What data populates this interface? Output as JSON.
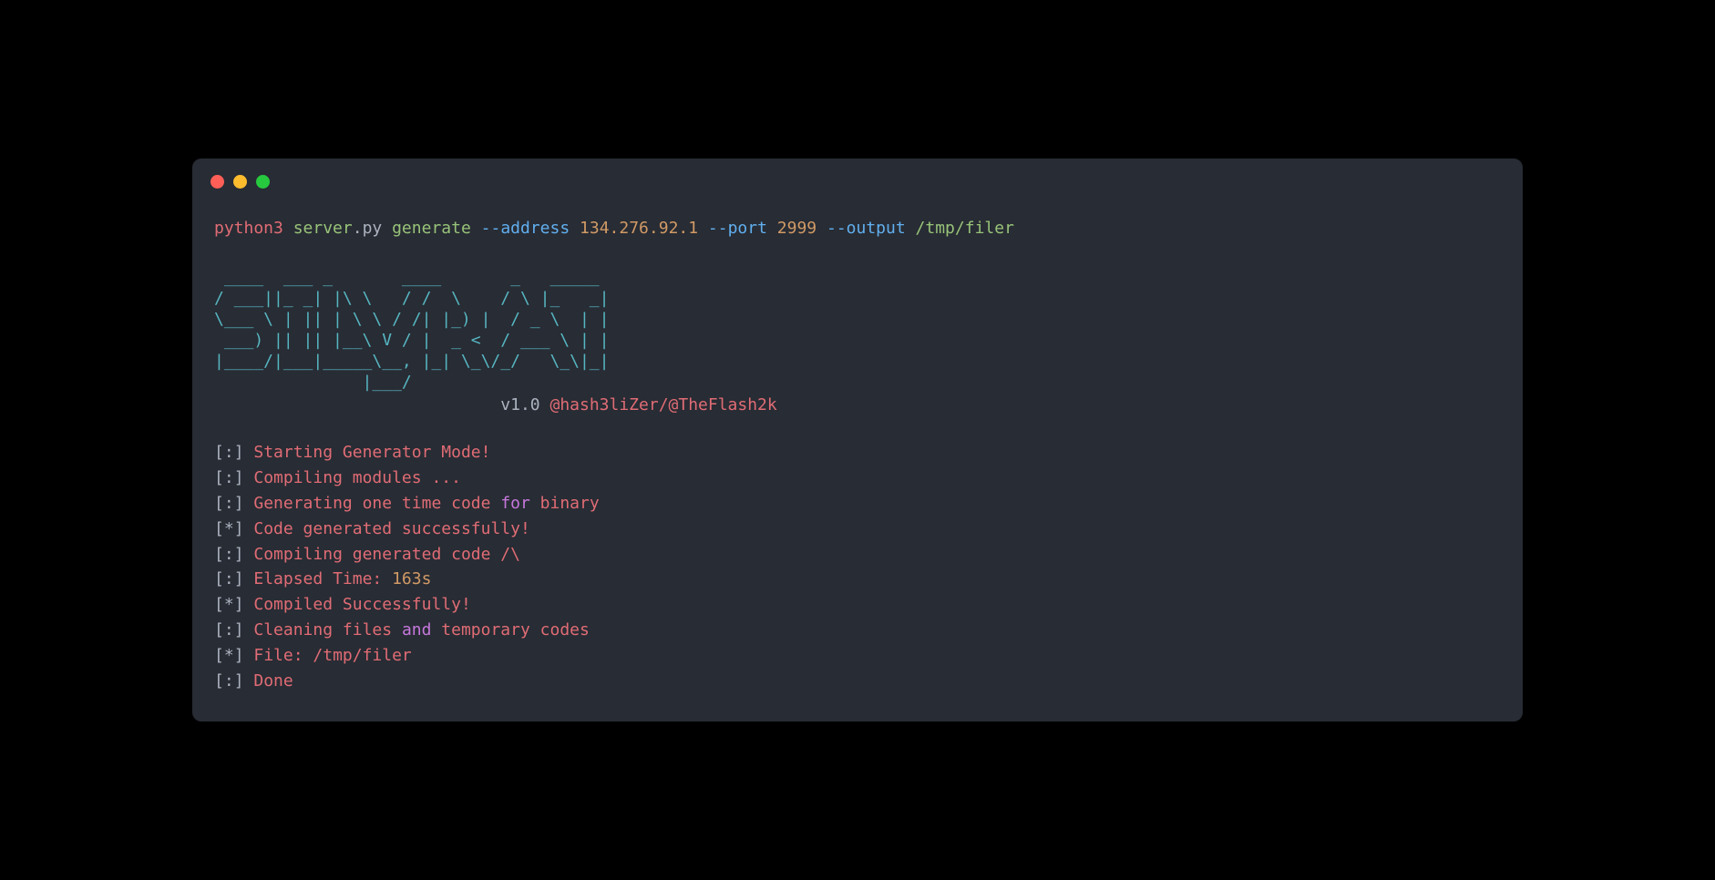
{
  "command": {
    "program": "python3",
    "script": "server",
    "dot_py": ".py",
    "subcmd": "generate",
    "flag_address": "--address",
    "address_val": "134.276.92.1",
    "flag_port": "--port",
    "port_val": "2999",
    "flag_output": "--output",
    "output_val": "/tmp/filer"
  },
  "ascii_art": " ____  ___ _       ____       _   _____ \n/ ___||_ _| |\\ \\   / /  \\    / \\ |_   _|\n\\___ \\ | || | \\ \\ / /| |_) |  / _ \\  | |  \n ___) || || |__\\ V / |  _ <  / ___ \\ | |  \n|____/|___|_____\\__, |_| \\_\\/_/   \\_\\|_|\n               |___/                         ",
  "credits": {
    "version": "v1.0",
    "handles": "@hash3liZer/@TheFlash2k",
    "indent": "                             "
  },
  "logs": [
    {
      "b_open": "[",
      "b_sym": ":",
      "b_close": "]",
      "parts": [
        {
          "t": "Starting Generator Mode!",
          "c": "c-red"
        }
      ]
    },
    {
      "b_open": "[",
      "b_sym": ":",
      "b_close": "]",
      "parts": [
        {
          "t": "Compiling modules ...",
          "c": "c-red"
        }
      ]
    },
    {
      "b_open": "[",
      "b_sym": ":",
      "b_close": "]",
      "parts": [
        {
          "t": "Generating one time code ",
          "c": "c-red"
        },
        {
          "t": "for",
          "c": "c-purple"
        },
        {
          "t": " binary",
          "c": "c-red"
        }
      ]
    },
    {
      "b_open": "[",
      "b_sym": "*",
      "b_close": "]",
      "parts": [
        {
          "t": "Code generated successfully!",
          "c": "c-red"
        }
      ]
    },
    {
      "b_open": "[",
      "b_sym": ":",
      "b_close": "]",
      "parts": [
        {
          "t": "Compiling generated code /\\",
          "c": "c-red"
        }
      ]
    },
    {
      "b_open": "[",
      "b_sym": ":",
      "b_close": "]",
      "parts": [
        {
          "t": "Elapsed Time: ",
          "c": "c-red"
        },
        {
          "t": "163s",
          "c": "c-yellow"
        }
      ]
    },
    {
      "b_open": "[",
      "b_sym": "*",
      "b_close": "]",
      "parts": [
        {
          "t": "Compiled Successfully!",
          "c": "c-red"
        }
      ]
    },
    {
      "b_open": "[",
      "b_sym": ":",
      "b_close": "]",
      "parts": [
        {
          "t": "Cleaning files ",
          "c": "c-red"
        },
        {
          "t": "and",
          "c": "c-purple"
        },
        {
          "t": " temporary codes",
          "c": "c-red"
        }
      ]
    },
    {
      "b_open": "[",
      "b_sym": "*",
      "b_close": "]",
      "parts": [
        {
          "t": "File: /tmp/filer",
          "c": "c-red"
        }
      ]
    },
    {
      "b_open": "[",
      "b_sym": ":",
      "b_close": "]",
      "parts": [
        {
          "t": "Done",
          "c": "c-red"
        }
      ]
    }
  ],
  "colors": {
    "red": "#e06c75",
    "green": "#98c379",
    "blue": "#61afef",
    "yellow": "#d19a66",
    "cyan": "#56b6c2",
    "purple": "#c678dd",
    "gray": "#abb2bf"
  }
}
